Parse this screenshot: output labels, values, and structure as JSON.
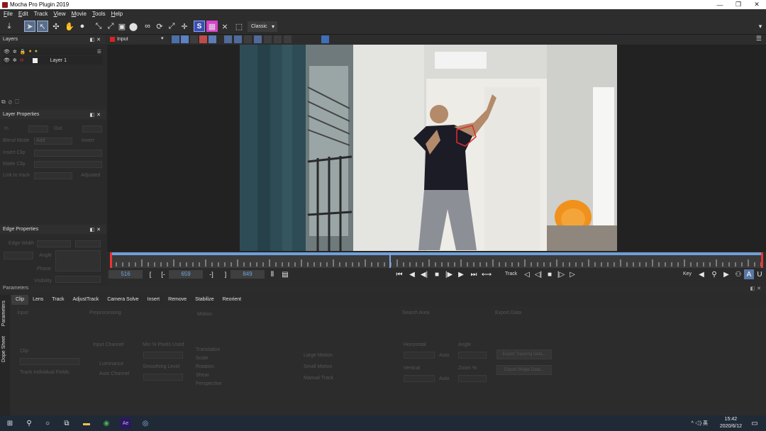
{
  "window": {
    "title": "Mocha Pro Plugin 2019",
    "controls": [
      "—",
      "❐",
      "✕"
    ]
  },
  "menu": [
    {
      "label": "File",
      "key": "F"
    },
    {
      "label": "Edit",
      "key": "E"
    },
    {
      "label": "Track",
      "key": ""
    },
    {
      "label": "View",
      "key": "V"
    },
    {
      "label": "Movie",
      "key": "M"
    },
    {
      "label": "Tools",
      "key": "T"
    },
    {
      "label": "Help",
      "key": "H"
    }
  ],
  "toolbar": {
    "layout_dropdown": "Classic",
    "s_label": "S"
  },
  "layers": {
    "title": "Layers",
    "layer_name": "Layer 1"
  },
  "layer_properties": {
    "title": "Layer Properties",
    "in_label": "In",
    "out_label": "Out",
    "blend_mode": "Blend Mode",
    "blend_value": "Add",
    "invert": "Invert",
    "insert_clip": "Insert Clip",
    "matte_clip": "Matte Clip",
    "link_to_track": "Link to track",
    "adjusted": "Adjusted"
  },
  "edge_properties": {
    "title": "Edge Properties",
    "edge_width": "Edge Width",
    "angle": "Angle",
    "phase": "Phase",
    "visibility": "Visibility"
  },
  "viewer": {
    "input_dropdown": "Input"
  },
  "transport": {
    "current_frame": "516",
    "in_frame": "659",
    "out_frame": "849",
    "track_label": "Track",
    "key_label": "Key"
  },
  "parameters": {
    "header": "Parameters",
    "tabs": [
      "Clip",
      "Lens",
      "Track",
      "AdjustTrack",
      "Camera Solve",
      "Insert",
      "Remove",
      "Stabilize",
      "Reorient"
    ],
    "active_tab": "Clip",
    "side_tabs": [
      "Parameters",
      "Dope Sheet"
    ],
    "sections": {
      "input": "Input",
      "preprocessing": "Preprocessing",
      "motion": "Motion",
      "search_area": "Search Area",
      "export_data": "Export Data"
    },
    "clip_label": "Clip",
    "track_individual_fields": "Track Individual Fields",
    "input_channel": "Input Channel",
    "luminance": "Luminance",
    "auto_channel": "Auto Channel",
    "min_pixels_used": "Min % Pixels Used",
    "smoothing_level": "Smoothing Level",
    "motion_options": [
      "Translation",
      "Scale",
      "Rotation",
      "Shear",
      "Perspective"
    ],
    "large_motion": "Large Motion",
    "small_motion": "Small Motion",
    "manual_track": "Manual Track",
    "horizontal": "Horizontal",
    "vertical": "Vertical",
    "auto": "Auto",
    "angle": "Angle",
    "zoom": "Zoom %",
    "export_tracking_data": "Export Tracking Data...",
    "export_shape_data": "Export Shape Data..."
  },
  "taskbar": {
    "time": "15:42",
    "date": "2020/6/12",
    "tray": "^  ◁) 英"
  },
  "colors": {
    "accent": "#6f9fd8",
    "mark": "#e33333",
    "bg": "#2b2b2b"
  }
}
